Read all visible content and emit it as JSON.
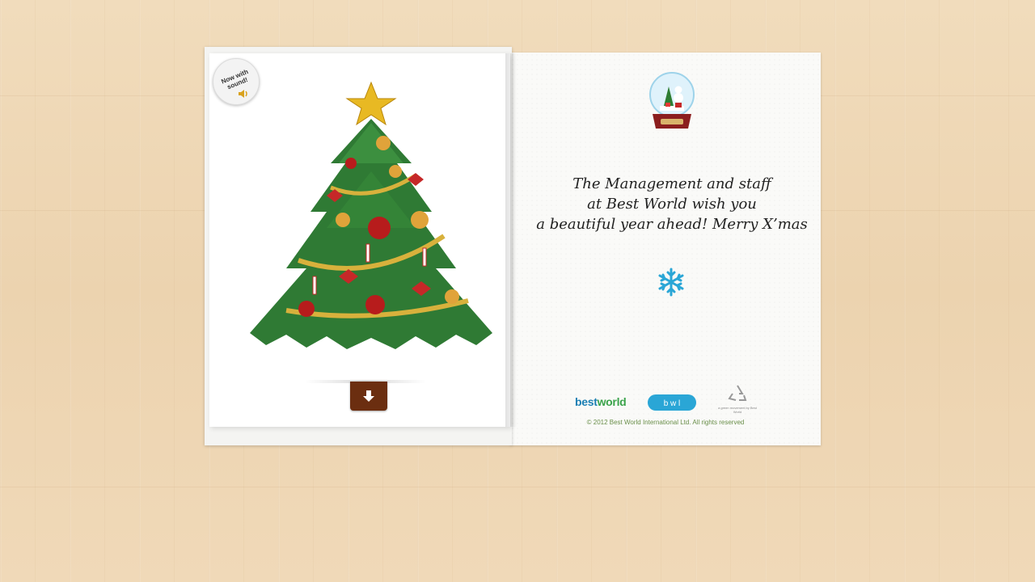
{
  "badge": {
    "line1": "Now with",
    "line2": "sound!"
  },
  "greeting": {
    "line1": "The Management and staff",
    "line2": "at Best World wish you",
    "line3": "a beautiful year ahead! Merry X’mas"
  },
  "logos": {
    "bestworld_a": "best",
    "bestworld_b": "world",
    "bwl": "b w l",
    "green": "a green movement by Best World"
  },
  "footer": {
    "copyright": "© 2012 Best World International Ltd. All rights reserved"
  },
  "icons": {
    "badge_speaker": "speaker-icon",
    "down_arrow": "arrow-down-icon",
    "globe": "snow-globe-icon",
    "snowflake": "snowflake-icon",
    "recycle": "recycle-icon"
  },
  "colors": {
    "wood": "#efd8b6",
    "button": "#6b2e10",
    "tree": "#2f7a34",
    "snowflake": "#2aa6d6",
    "copyright": "#6a8f4a"
  }
}
